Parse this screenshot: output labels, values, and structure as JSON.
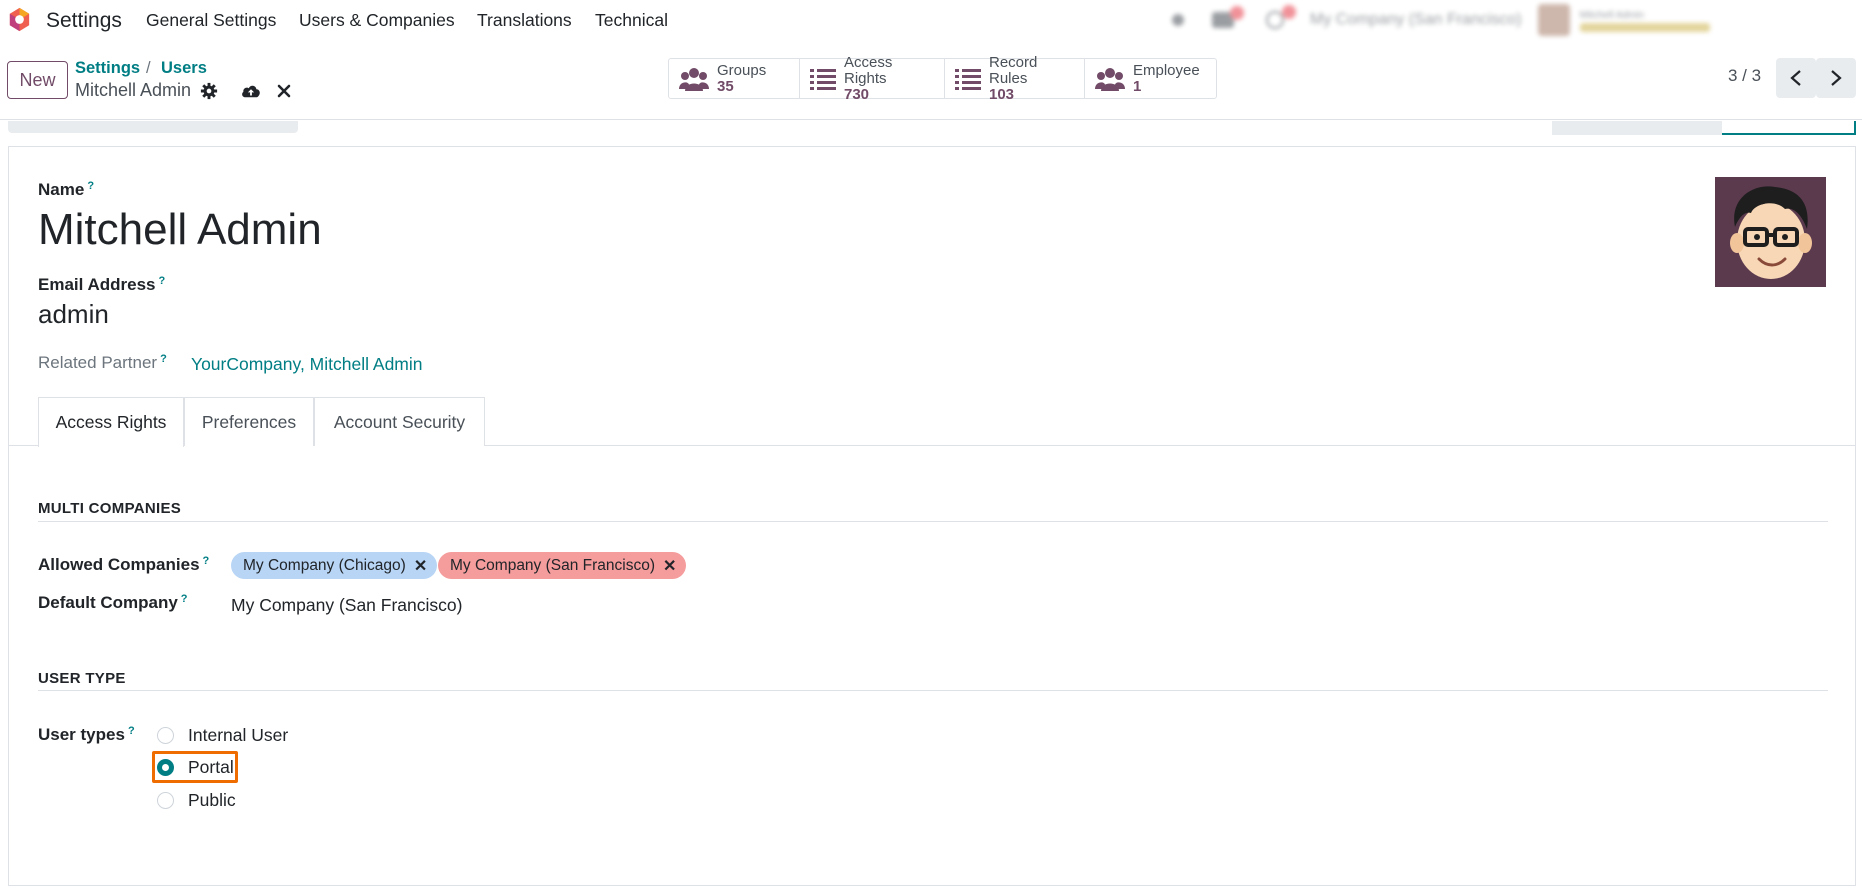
{
  "topbar": {
    "app_name": "Settings",
    "menu": [
      "General Settings",
      "Users & Companies",
      "Translations",
      "Technical"
    ],
    "company_switcher": "My Company (San Francisco)",
    "user_name": "Mitchell Admin",
    "user_db": "Mitchell Admin"
  },
  "control": {
    "new_label": "New",
    "breadcrumb": [
      "Settings",
      "Users"
    ],
    "breadcrumb_sep": "/",
    "record_name": "Mitchell Admin",
    "pager": "3 / 3"
  },
  "smart_buttons": [
    {
      "label": "Groups",
      "value": "35",
      "icon": "users-icon"
    },
    {
      "label": "Access Rights",
      "value": "730",
      "icon": "list-icon"
    },
    {
      "label": "Record Rules",
      "value": "103",
      "icon": "list-icon"
    },
    {
      "label": "Employee",
      "value": "1",
      "icon": "users-icon"
    }
  ],
  "form": {
    "name_label": "Name",
    "name_value": "Mitchell Admin",
    "email_label": "Email Address",
    "email_value": "admin",
    "partner_label": "Related Partner",
    "partner_value": "YourCompany, Mitchell Admin",
    "help_mark": "?"
  },
  "tabs": [
    "Access Rights",
    "Preferences",
    "Account Security"
  ],
  "access_rights": {
    "multi_companies_title": "MULTI COMPANIES",
    "allowed_companies_label": "Allowed Companies",
    "allowed_companies": [
      {
        "name": "My Company (Chicago)",
        "color": "#b8d5f5"
      },
      {
        "name": "My Company (San Francisco)",
        "color": "#f59c9c"
      }
    ],
    "default_company_label": "Default Company",
    "default_company_value": "My Company (San Francisco)",
    "user_type_title": "USER TYPE",
    "user_types_label": "User types",
    "user_types": [
      "Internal User",
      "Portal",
      "Public"
    ],
    "selected_user_type": "Portal"
  },
  "colors": {
    "brand": "#714b67",
    "accent": "#017e84",
    "highlight": "#ef6c00"
  }
}
